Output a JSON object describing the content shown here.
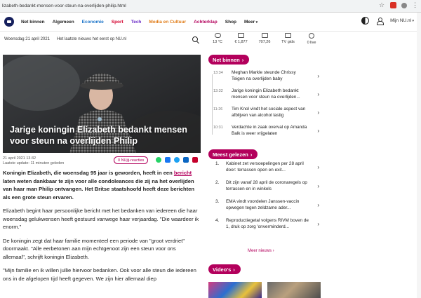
{
  "browser": {
    "url": "lizabeth-bedankt-mensen-voor-steun-na-overlijden-philip.html"
  },
  "header": {
    "nav_items": [
      {
        "label": "Net binnen",
        "color": "#222222"
      },
      {
        "label": "Algemeen",
        "color": "#222222"
      },
      {
        "label": "Economie",
        "color": "#1a73c8"
      },
      {
        "label": "Sport",
        "color": "#d4002d"
      },
      {
        "label": "Tech",
        "color": "#6a2bc7"
      },
      {
        "label": "Media en Cultuur",
        "color": "#e07a14"
      },
      {
        "label": "Achterklap",
        "color": "#b3005c"
      },
      {
        "label": "Shop",
        "color": "#222222"
      },
      {
        "label": "Meer",
        "color": "#222222"
      }
    ],
    "my_nu": "Mijn NU.nl"
  },
  "datebar": {
    "date": "Woensdag 21 april 2021",
    "tagline": "Het laatste nieuws het eerst op NU.nl"
  },
  "article": {
    "title": "Jarige koningin Elizabeth bedankt mensen voor steun na overlijden Philip",
    "published": "21 april 2021 13:32",
    "updated": "Laatste update: 11 minuten geleden",
    "reactions": "0 NUjij-reacties",
    "lead_before": "Koningin Elizabeth, die woensdag 95 jaar is geworden, heeft in een ",
    "lead_link": "bericht",
    "lead_after": " laten weten dankbaar te zijn voor alle condoleances die zij na het overlijden van haar man Philip ontvangen. Het Britse staatshoofd heeft deze berichten als een grote steun ervaren.",
    "paragraph_1": "Elizabeth begint haar persoonlijke bericht met het bedanken van iedereen die haar woensdag gelukwensen heeft gestuurd vanwege haar verjaardag. \"Die waardeer ik enorm.\"",
    "paragraph_2": "De koningin zegt dat haar familie momenteel een periode van \"groot verdriet\" doormaakt. \"Alle eerbetonen aan mijn echtgenoot zijn een steun voor ons allemaal\", schrijft koningin Elizabeth.",
    "paragraph_3": "\"Mijn familie en ik willen jullie hiervoor bedanken. Ook voor alle steun die iedereen ons in de afgelopen tijd heeft gegeven. We zijn hier allemaal diep"
  },
  "widgets": [
    {
      "icon": "weather-icon",
      "value": "13 °C"
    },
    {
      "icon": "aex-icon",
      "value": "€ 1,877"
    },
    {
      "icon": "exchange-icon",
      "value": "707,26"
    },
    {
      "icon": "tv-guide-icon",
      "value": "TV gids"
    },
    {
      "icon": "live-icon",
      "value": "0 live"
    }
  ],
  "net_binnen": {
    "heading": "Net binnen",
    "items": [
      {
        "time": "13:34",
        "text": "Meghan Markle steunde Chrissy Teigen na overlijden baby"
      },
      {
        "time": "13:32",
        "text": "Jarige koningin Elizabeth bedankt mensen voor steun na overlijden..."
      },
      {
        "time": "11:26",
        "text": "Tim Knol vindt het sociale aspect van afblijven van alcohol lastig"
      },
      {
        "time": "10:31",
        "text": "Verdachte in zaak overval op Amanda Balk is weer vrijgelaten"
      }
    ]
  },
  "meest_gelezen": {
    "heading": "Meest gelezen",
    "items": [
      {
        "num": "1.",
        "text": "Kabinet zet versoepelingen per 28 april door: terrassen open en exit..."
      },
      {
        "num": "2.",
        "text": "Dit zijn vanaf 28 april de coronaregels op terrassen en in winkels"
      },
      {
        "num": "3.",
        "text": "EMA vindt voordelen Janssen-vaccin opwegen tegen zeldzame ader..."
      },
      {
        "num": "4.",
        "text": "Reproductiegetal volgens RIVM boven de 1, druk op zorg 'onverminderd..."
      }
    ],
    "more": "Meer nieuws"
  },
  "videos": {
    "heading": "Video's"
  }
}
